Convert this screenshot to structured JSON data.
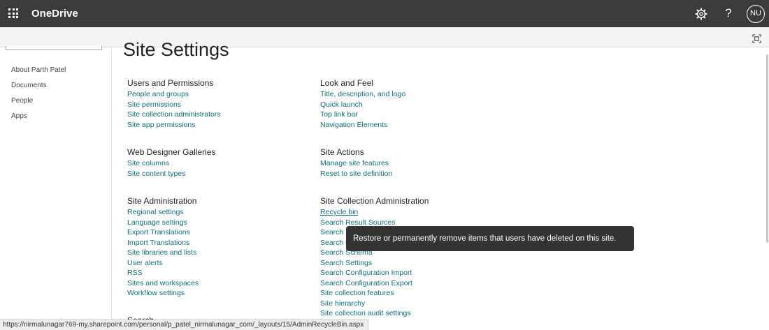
{
  "topbar": {
    "app_title": "OneDrive",
    "help_glyph": "?",
    "avatar_initials": "NU",
    "icons": [
      "app-launcher-icon",
      "gear-icon",
      "help-icon",
      "focus-mode-icon"
    ]
  },
  "leftnav": {
    "items": [
      {
        "label": "About Parth Patel"
      },
      {
        "label": "Documents"
      },
      {
        "label": "People"
      },
      {
        "label": "Apps"
      }
    ]
  },
  "main": {
    "title": "Site Settings",
    "groups": [
      {
        "heading": "Users and Permissions",
        "links": [
          "People and groups",
          "Site permissions",
          "Site collection administrators",
          "Site app permissions"
        ]
      },
      {
        "heading": "Web Designer Galleries",
        "links": [
          "Site columns",
          "Site content types"
        ]
      },
      {
        "heading": "Site Administration",
        "links": [
          "Regional settings",
          "Language settings",
          "Export Translations",
          "Import Translations",
          "Site libraries and lists",
          "User alerts",
          "RSS",
          "Sites and workspaces",
          "Workflow settings"
        ]
      },
      {
        "heading": "Search",
        "links": []
      },
      {
        "heading": "Look and Feel",
        "links": [
          "Title, description, and logo",
          "Quick launch",
          "Top link bar",
          "Navigation Elements"
        ]
      },
      {
        "heading": "Site Actions",
        "links": [
          "Manage site features",
          "Reset to site definition"
        ]
      },
      {
        "heading": "Site Collection Administration",
        "links": [
          "Recycle bin",
          "Search Result Sources",
          "Search Result Types",
          "Search Query Rules",
          "Search Schema",
          "Search Settings",
          "Search Configuration Import",
          "Search Configuration Export",
          "Site collection features",
          "Site hierarchy",
          "Site collection audit settings"
        ]
      }
    ]
  },
  "tooltip": {
    "text": "Restore or permanently remove items that users have deleted on this site."
  },
  "statusbar": {
    "url": "https://nirmalunagar769-my.sharepoint.com/personal/p_patel_nirmalunagar_com/_layouts/15/AdminRecycleBin.aspx"
  },
  "colors": {
    "topbar": "#3b3b3b",
    "link": "#0f6e7a",
    "tooltip": "#333333"
  }
}
